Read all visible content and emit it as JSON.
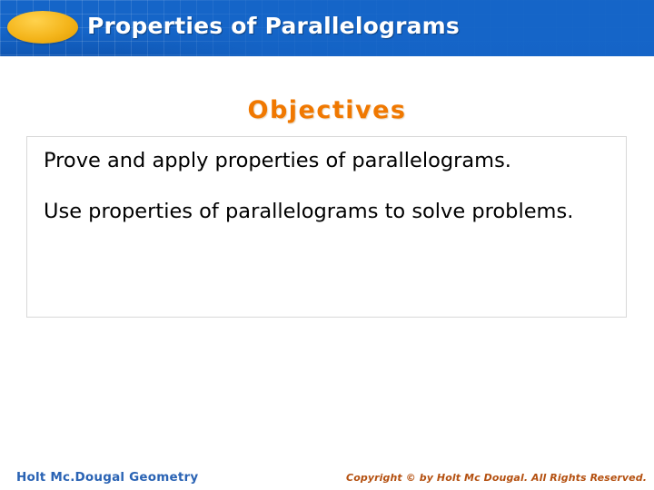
{
  "header": {
    "title": "Properties of Parallelograms"
  },
  "main": {
    "objectives_heading": "Objectives",
    "objectives": [
      "Prove and apply properties of parallelograms.",
      "Use properties of parallelograms to solve problems."
    ]
  },
  "footer": {
    "left": "Holt Mc.Dougal Geometry",
    "right": "Copyright © by Holt Mc Dougal. All Rights Reserved."
  },
  "colors": {
    "header_blue": "#1565c8",
    "accent_orange": "#f07800",
    "ellipse_gold": "#f4b51b",
    "footer_blue": "#2a63b4",
    "footer_brown": "#b45010"
  }
}
